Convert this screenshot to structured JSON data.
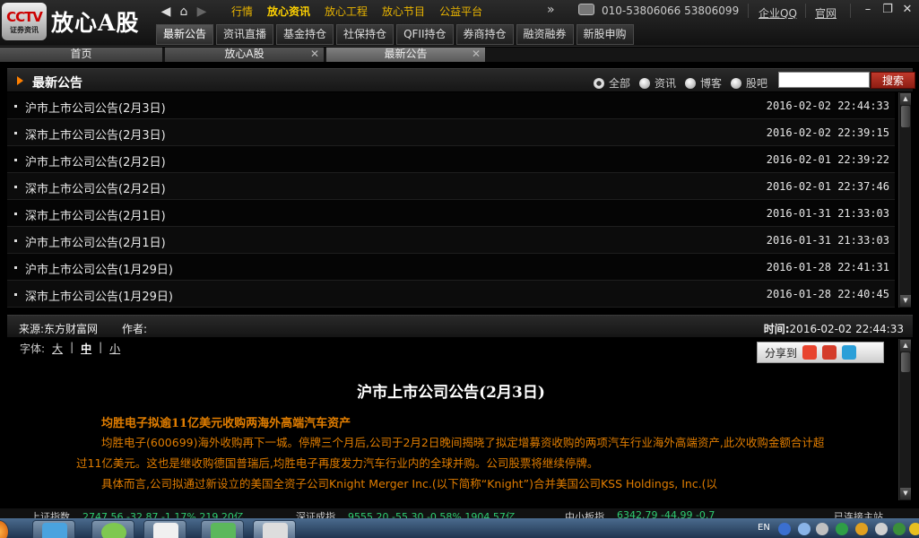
{
  "app": {
    "logo_text": "CCTV",
    "logo_sub": "证券资讯",
    "title": "放心A股"
  },
  "menu": {
    "items": [
      "行情",
      "放心资讯",
      "放心工程",
      "放心节目",
      "公益平台"
    ],
    "active": "放心资讯"
  },
  "contact": {
    "phone": "010-53806066 53806099",
    "qq_link": "企业QQ",
    "site_link": "官网"
  },
  "subtabs": [
    "最新公告",
    "资讯直播",
    "基金持仓",
    "社保持仓",
    "QFII持仓",
    "券商持仓",
    "融资融券",
    "新股申购"
  ],
  "pagetabs": [
    {
      "label": "首页",
      "closable": false
    },
    {
      "label": "放心A股",
      "closable": true
    },
    {
      "label": "最新公告",
      "closable": true,
      "active": true
    }
  ],
  "list_section": {
    "title": "最新公告",
    "filters": [
      "全部",
      "资讯",
      "博客",
      "股吧"
    ],
    "selected_filter": "全部",
    "search_placeholder": "",
    "search_button": "搜索",
    "rows": [
      {
        "title": "沪市上市公司公告(2月3日)",
        "time": "2016-02-02 22:44:33"
      },
      {
        "title": "深市上市公司公告(2月3日)",
        "time": "2016-02-02 22:39:15"
      },
      {
        "title": "沪市上市公司公告(2月2日)",
        "time": "2016-02-01 22:39:22"
      },
      {
        "title": "深市上市公司公告(2月2日)",
        "time": "2016-02-01 22:37:46"
      },
      {
        "title": "深市上市公司公告(2月1日)",
        "time": "2016-01-31 21:33:03"
      },
      {
        "title": "沪市上市公司公告(2月1日)",
        "time": "2016-01-31 21:33:03"
      },
      {
        "title": "沪市上市公司公告(1月29日)",
        "time": "2016-01-28 22:41:31"
      },
      {
        "title": "深市上市公司公告(1月29日)",
        "time": "2016-01-28 22:40:45"
      }
    ]
  },
  "detail": {
    "source": "来源:东方财富网",
    "author": "作者:",
    "time_label": "时间:",
    "time_value": "2016-02-02 22:44:33",
    "font_label": "字体:",
    "font_sizes": [
      "大",
      "中",
      "小"
    ],
    "current_font_size": "中",
    "share_label": "分享到",
    "article_title": "沪市上市公司公告(2月3日)",
    "subheading": "均胜电子拟逾11亿美元收购两海外高端汽车资产",
    "paragraph1": "均胜电子(600699)海外收购再下一城。停牌三个月后,公司于2月2日晚间揭晓了拟定增募资收购的两项汽车行业海外高端资产,此次收购金额合计超过11亿美元。这也是继收购德国普瑞后,均胜电子再度发力汽车行业内的全球并购。公司股票将继续停牌。",
    "paragraph2": "具体而言,公司拟通过新设立的美国全资子公司Knight Merger Inc.(以下简称“Knight”)合并美国公司KSS Holdings, Inc.(以"
  },
  "ticker": {
    "item1_name": "上证指数",
    "item1_values": "2747.56   -32.87  -1.17%   219.20亿",
    "item2_name": "深证成指",
    "item2_values": "9555.20  -55.30  -0.58%   1904.57亿",
    "item3_name": "中小板指",
    "item3_values": "6342.79  -44.99  -0.7",
    "item4_text": "已连接主站"
  },
  "taskbar": {
    "tray_lang": "EN"
  },
  "colors": {
    "menu_text": "#e9b400",
    "article_text": "#e07d00",
    "search_button": "#c0392b",
    "bullet_triangle": "#ff8000"
  }
}
